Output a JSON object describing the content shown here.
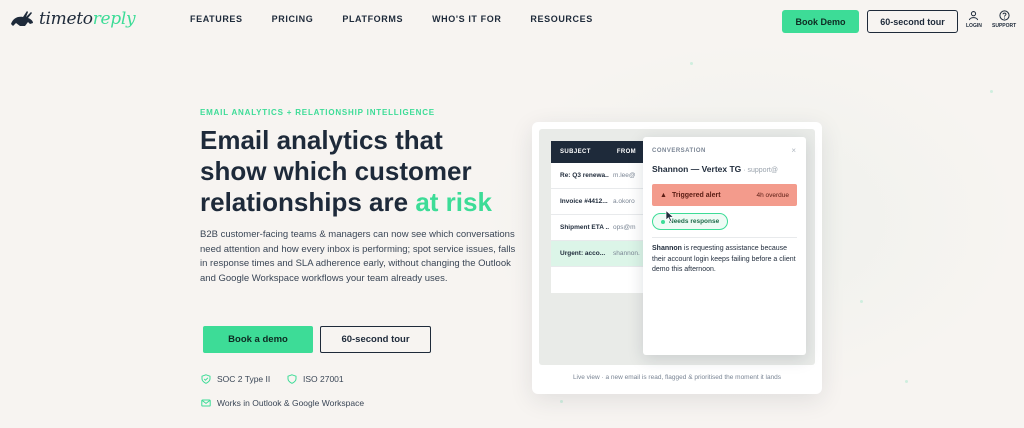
{
  "nav": {
    "logo_prefix": "timeto",
    "logo_accent": "reply",
    "links": [
      "FEATURES",
      "PRICING",
      "PLATFORMS",
      "WHO'S IT FOR",
      "RESOURCES"
    ],
    "book_demo": "Book Demo",
    "tour": "60-second tour",
    "login": "LOGIN",
    "support": "SUPPORT"
  },
  "hero": {
    "eyebrow": "EMAIL ANALYTICS + RELATIONSHIP INTELLIGENCE",
    "headline_line1": "Email analytics that",
    "headline_line2": "show which customer",
    "headline_line3": "relationships are ",
    "headline_accent": "at risk",
    "description": "B2B customer-facing teams & managers can now see which conversations need attention and how every inbox is performing; spot service issues, falls in response times and SLA adherence early, without changing the Outlook and Google Workspace workflows your team already uses.",
    "cta_demo": "Book a demo",
    "cta_tour": "60-second tour",
    "badge_soc": "SOC 2 Type II",
    "badge_iso": "ISO 27001",
    "badge_works": "Works in Outlook & Google Workspace"
  },
  "inbox": {
    "col_subject": "SUBJECT",
    "col_from": "FROM",
    "rows": [
      {
        "subject": "Re: Q3 renewa...",
        "from": "m.lee@"
      },
      {
        "subject": "Invoice #4412...",
        "from": "a.okoro"
      },
      {
        "subject": "Shipment ETA ...",
        "from": "ops@m"
      },
      {
        "subject": "Urgent: acco...",
        "from": "shannon."
      }
    ]
  },
  "conversation": {
    "label": "CONVERSATION",
    "close": "×",
    "name": "Shannon — Vertex TG",
    "email": " · support@",
    "alert_icon": "▲",
    "alert_text": "Triggered alert",
    "alert_overdue": "4h overdue",
    "status": "Needs response",
    "body_name": "Shannon",
    "body_text": " is requesting assistance because their account login keeps failing before a client demo this afternoon."
  },
  "caption": "Live view · a new email is read, flagged & prioritised the moment it lands",
  "colors": {
    "accent": "#3ddc97",
    "navy": "#1e2a3a",
    "alert": "#f39b8c"
  }
}
